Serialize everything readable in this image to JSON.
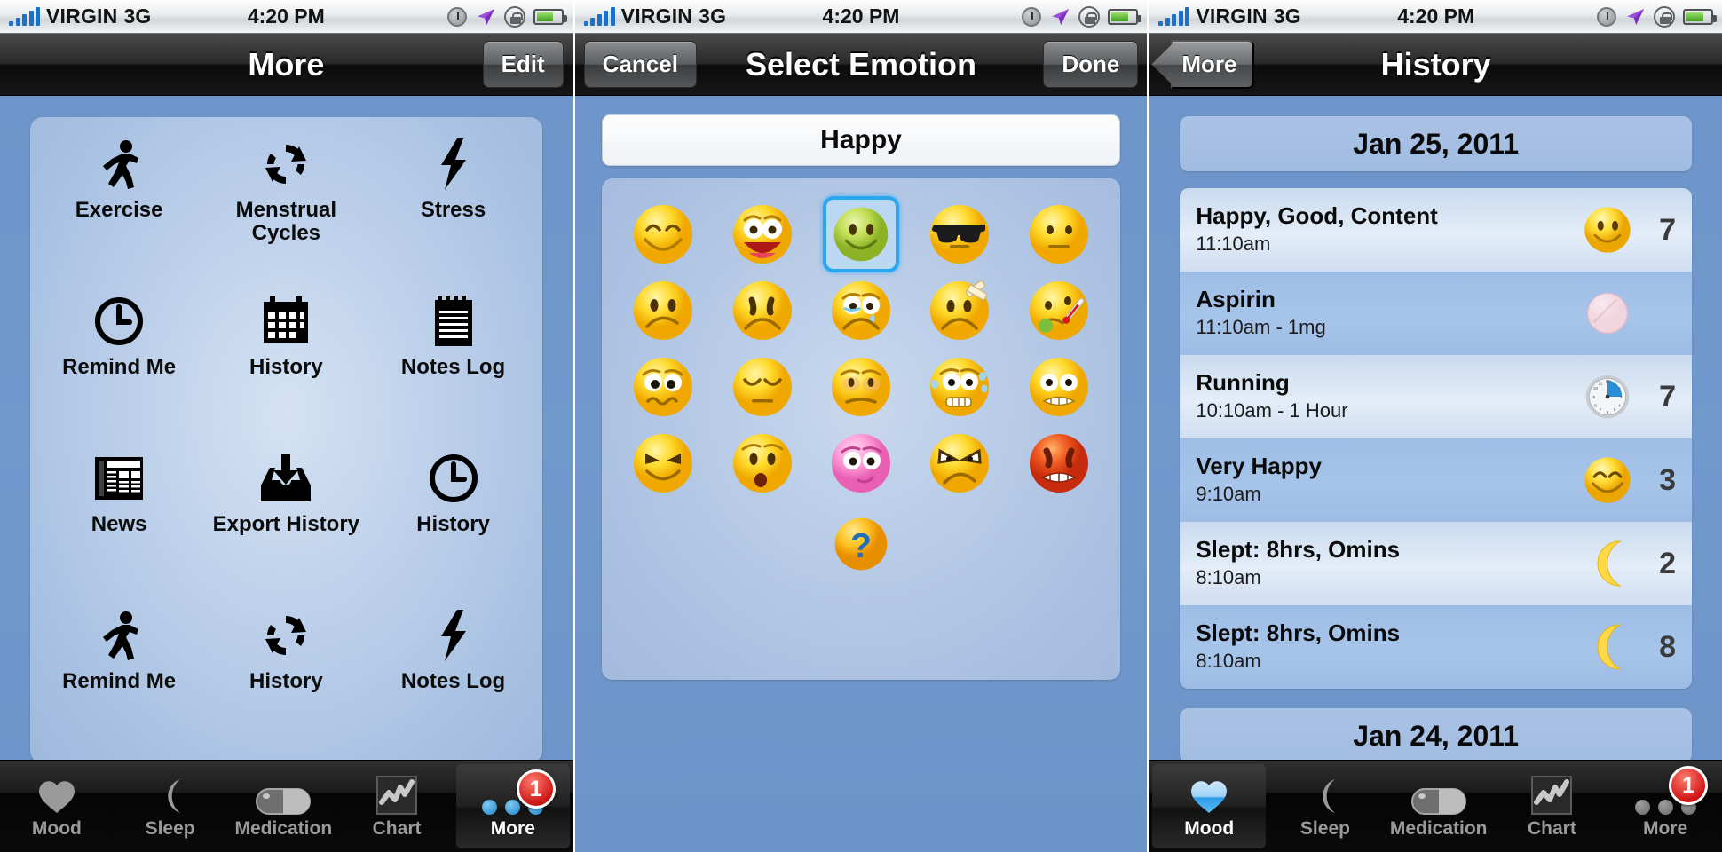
{
  "status_bar": {
    "carrier": "VIRGIN",
    "network": "3G",
    "time": "4:20 PM",
    "icons": [
      "alarm-clock-icon",
      "location-arrow-icon",
      "rotation-lock-icon",
      "battery-icon"
    ]
  },
  "screen_more": {
    "nav": {
      "title": "More",
      "edit_label": "Edit"
    },
    "grid": [
      {
        "label": "Exercise",
        "icon": "running-person-icon"
      },
      {
        "label": "Menstrual Cycles",
        "icon": "cycle-arrows-icon"
      },
      {
        "label": "Stress",
        "icon": "lightning-bolt-icon"
      },
      {
        "label": "Remind Me",
        "icon": "clock-icon"
      },
      {
        "label": "History",
        "icon": "calendar-icon"
      },
      {
        "label": "Notes Log",
        "icon": "notepad-icon"
      },
      {
        "label": "News",
        "icon": "newspaper-icon"
      },
      {
        "label": "Export History",
        "icon": "inbox-download-icon"
      },
      {
        "label": "History",
        "icon": "clock-icon"
      },
      {
        "label": "Remind Me",
        "icon": "running-person-icon"
      },
      {
        "label": "History",
        "icon": "cycle-arrows-icon"
      },
      {
        "label": "Notes Log",
        "icon": "lightning-bolt-icon"
      }
    ],
    "tabs": [
      {
        "label": "Mood",
        "icon": "heart-icon",
        "selected": false
      },
      {
        "label": "Sleep",
        "icon": "moon-icon",
        "selected": false
      },
      {
        "label": "Medication",
        "icon": "pill-icon",
        "selected": false
      },
      {
        "label": "Chart",
        "icon": "line-chart-icon",
        "selected": false
      },
      {
        "label": "More",
        "icon": "more-dots-icon",
        "selected": true,
        "badge": "1"
      }
    ]
  },
  "screen_emotion": {
    "nav": {
      "cancel_label": "Cancel",
      "title": "Select Emotion",
      "done_label": "Done"
    },
    "selected_emotion": "Happy",
    "rows": [
      [
        {
          "name": "smiling-closed-eyes-face",
          "selected": false
        },
        {
          "name": "laughing-open-mouth-face",
          "selected": false
        },
        {
          "name": "green-smiling-face",
          "selected": true
        },
        {
          "name": "sunglasses-face",
          "selected": false
        },
        {
          "name": "neutral-face",
          "selected": false
        }
      ],
      [
        {
          "name": "slightly-frowning-face",
          "selected": false
        },
        {
          "name": "sad-face",
          "selected": false
        },
        {
          "name": "crying-face",
          "selected": false
        },
        {
          "name": "injured-bandage-face",
          "selected": false
        },
        {
          "name": "sick-thermometer-face",
          "selected": false
        }
      ],
      [
        {
          "name": "confused-wavy-mouth-face",
          "selected": false
        },
        {
          "name": "sleepy-closed-eyes-face",
          "selected": false
        },
        {
          "name": "worried-blushing-face",
          "selected": false
        },
        {
          "name": "anxious-sweat-face",
          "selected": false
        },
        {
          "name": "grimacing-face",
          "selected": false
        }
      ],
      [
        {
          "name": "mischievous-smile-face",
          "selected": false
        },
        {
          "name": "surprised-oh-face",
          "selected": false
        },
        {
          "name": "pink-blushing-face",
          "selected": false
        },
        {
          "name": "angry-face",
          "selected": false
        },
        {
          "name": "red-furious-face",
          "selected": false
        }
      ]
    ],
    "help_button": {
      "name": "question-mark-icon",
      "label": "?"
    }
  },
  "screen_history": {
    "nav": {
      "back_label": "More",
      "title": "History"
    },
    "sections": [
      {
        "date": "Jan 25, 2011",
        "entries": [
          {
            "title": "Happy, Good, Content",
            "subtitle": "11:10am",
            "icon": "smiley-face-icon",
            "value": "7"
          },
          {
            "title": "Aspirin",
            "subtitle": "11:10am  -  1mg",
            "icon": "pill-icon",
            "value": ""
          },
          {
            "title": "Running",
            "subtitle": "10:10am  -  1 Hour",
            "icon": "clock-face-icon",
            "value": "7"
          },
          {
            "title": "Very Happy",
            "subtitle": "9:10am",
            "icon": "very-happy-icon",
            "value": "3"
          },
          {
            "title": "Slept: 8hrs, Omins",
            "subtitle": "8:10am",
            "icon": "moon-icon",
            "value": "2"
          },
          {
            "title": "Slept: 8hrs, Omins",
            "subtitle": "8:10am",
            "icon": "moon-icon",
            "value": "8"
          }
        ]
      },
      {
        "date": "Jan 24, 2011",
        "entries": []
      }
    ],
    "tabs": [
      {
        "label": "Mood",
        "icon": "heart-icon",
        "selected": true
      },
      {
        "label": "Sleep",
        "icon": "moon-icon",
        "selected": false
      },
      {
        "label": "Medication",
        "icon": "pill-icon",
        "selected": false
      },
      {
        "label": "Chart",
        "icon": "line-chart-icon",
        "selected": false
      },
      {
        "label": "More",
        "icon": "more-dots-icon",
        "selected": false,
        "badge": "1"
      }
    ]
  },
  "colors": {
    "bg_blue": "#6d94c8",
    "card_blue": "#b6cae6",
    "accent_blue": "#2aa6f0",
    "badge_red": "#cf1616"
  }
}
